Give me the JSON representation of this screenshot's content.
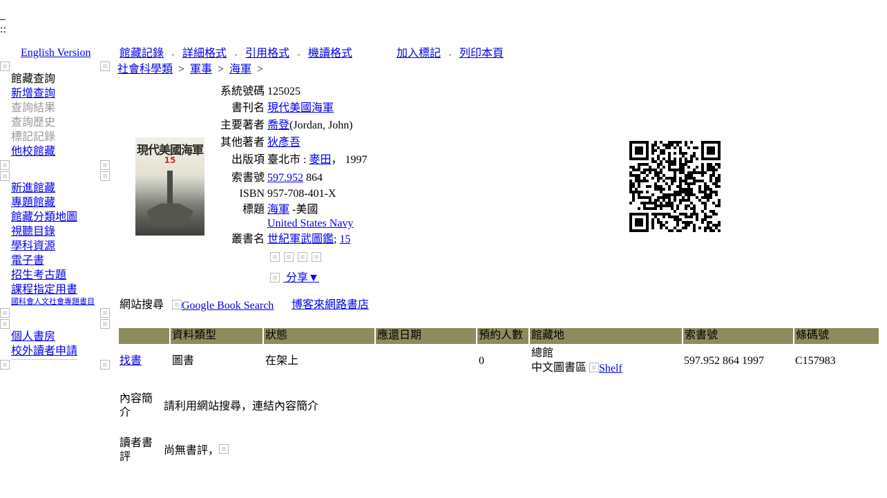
{
  "top": {
    "underscore": "_",
    "separator": "::"
  },
  "english_version": "English Version",
  "format_tabs": [
    {
      "label": "館藏記錄"
    },
    {
      "label": "詳細格式"
    },
    {
      "label": "引用格式"
    },
    {
      "label": "機讀格式"
    }
  ],
  "action_links": [
    {
      "label": "加入標記"
    },
    {
      "label": "列印本頁"
    }
  ],
  "breadcrumb": [
    "社會科學類",
    "軍事",
    "海軍"
  ],
  "breadcrumb_separator": ">",
  "sidebar": {
    "section1": [
      {
        "label": "館藏查詢",
        "state": "current"
      },
      {
        "label": "新增查詢",
        "state": "link"
      },
      {
        "label": "查詢結果",
        "state": "disabled"
      },
      {
        "label": "查詢歷史",
        "state": "disabled"
      },
      {
        "label": "標記記錄",
        "state": "disabled"
      },
      {
        "label": "他校館藏",
        "state": "link"
      }
    ],
    "section2": [
      {
        "label": "新進館藏"
      },
      {
        "label": "專題館藏"
      },
      {
        "label": "館藏分類地圖"
      },
      {
        "label": "視聽目錄"
      },
      {
        "label": "學科資源"
      },
      {
        "label": "電子書"
      },
      {
        "label": "招生考古題"
      },
      {
        "label": "課程指定用書"
      },
      {
        "label": "國科會人文社會專題書目"
      }
    ],
    "section3": [
      {
        "label": "個人書房"
      },
      {
        "label": "校外讀者申請"
      }
    ]
  },
  "cover": {
    "title": "現代美國海軍",
    "number": "15"
  },
  "record": {
    "system_no": {
      "label": "系統號碼",
      "value": "125025"
    },
    "title": {
      "label": "書刊名",
      "value": "現代美國海軍"
    },
    "main_author": {
      "label": "主要著者",
      "name": "喬登",
      "extra": "(Jordan, John)"
    },
    "other_author": {
      "label": "其他著者",
      "name": "狄彥吾"
    },
    "publication": {
      "label": "出版項",
      "place": "臺北市 : ",
      "publisher": "麥田",
      "year": "， 1997"
    },
    "call_no": {
      "label": "索書號",
      "class_no": "597.952",
      "rest": " 864"
    },
    "isbn": {
      "label": "ISBN",
      "value": "957-708-401-X"
    },
    "subject": {
      "label": "標題",
      "link": "海軍",
      "rest": " -美國",
      "english": "United States Navy"
    },
    "series": {
      "label": "叢書名",
      "link": "世紀軍武圖鑑",
      "number": "15"
    }
  },
  "share_label": "分享",
  "web_search": {
    "label": "網站搜尋",
    "google_alt": "Google Book Search",
    "books_link": "博客來網路書店"
  },
  "holdings": {
    "headers": [
      "",
      "資料類型",
      "狀態",
      "應還日期",
      "預約人數",
      "館藏地",
      "索書號",
      "條碼號"
    ],
    "rows": [
      {
        "action": "找書",
        "type": "圖書",
        "status": "在架上",
        "due": "",
        "holds": "0",
        "location_line1": "總館",
        "location_line2": "中文圖書區",
        "shelf_alt": "Shelf",
        "call_no": "597.952 864 1997",
        "barcode": "C157983"
      }
    ]
  },
  "summary": {
    "label": "內容簡介",
    "text": "請利用網站搜尋，連結內容簡介"
  },
  "review": {
    "label": "讀者書評",
    "text": "尚無書評，"
  },
  "colors": {
    "link": "#0000ee",
    "table_header": "#8c8c5e",
    "disabled": "#999999"
  }
}
